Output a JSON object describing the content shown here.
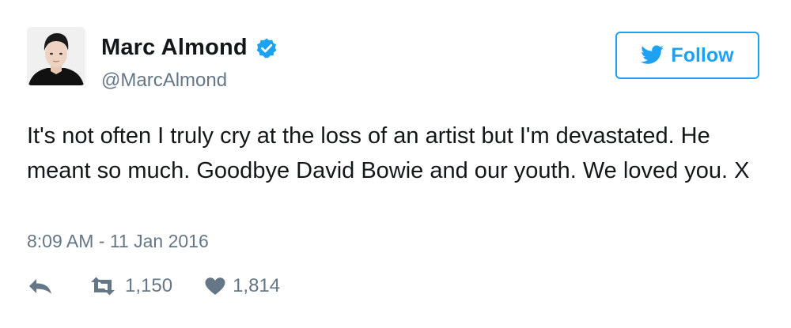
{
  "user": {
    "display_name": "Marc Almond",
    "handle": "@MarcAlmond",
    "verified": true,
    "avatar_icon": "profile-photo"
  },
  "follow_button": {
    "label": "Follow",
    "icon": "twitter-bird-icon",
    "color": "#1da1f2"
  },
  "tweet": {
    "text": "It's not often I truly cry at the loss of an artist but I'm devastated. He meant so much. Goodbye David Bowie and our youth. We loved you. X",
    "timestamp": "8:09 AM - 11 Jan 2016"
  },
  "actions": {
    "reply_icon": "reply-icon",
    "retweet_icon": "retweet-icon",
    "retweet_count": "1,150",
    "like_icon": "heart-icon",
    "like_count": "1,814"
  },
  "colors": {
    "text": "#14171a",
    "muted": "#657786",
    "accent": "#1da1f2"
  }
}
